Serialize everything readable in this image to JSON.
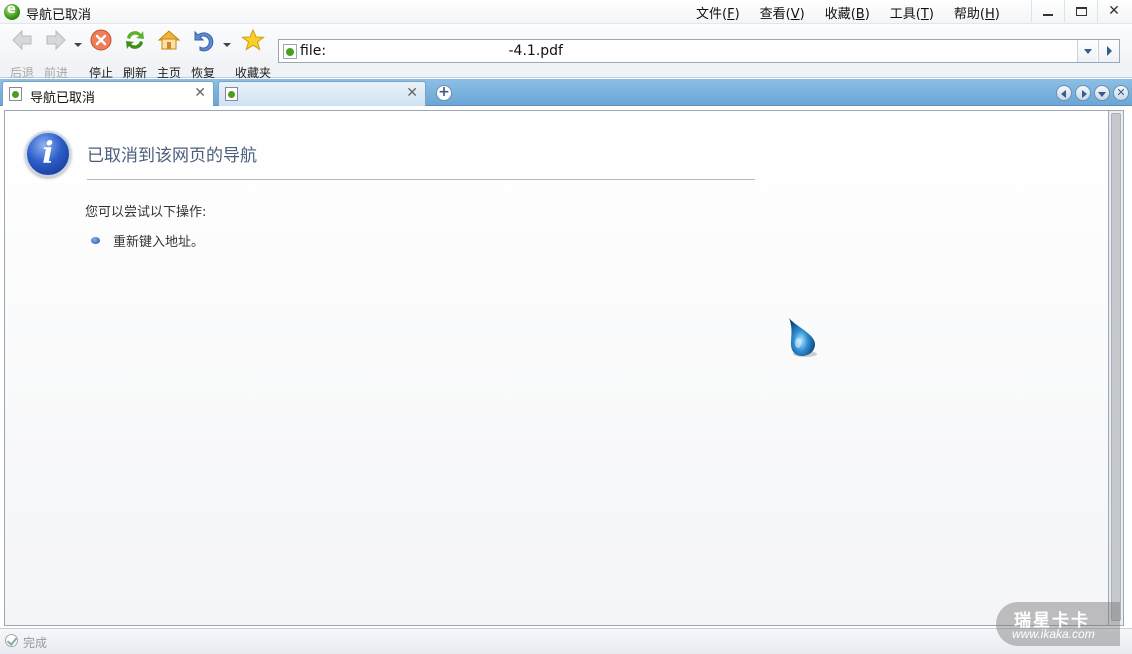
{
  "window": {
    "title": "导航已取消"
  },
  "menu": [
    {
      "label": "文件(",
      "key": "F",
      "suffix": ")"
    },
    {
      "label": "查看(",
      "key": "V",
      "suffix": ")"
    },
    {
      "label": "收藏(",
      "key": "B",
      "suffix": ")"
    },
    {
      "label": "工具(",
      "key": "T",
      "suffix": ")"
    },
    {
      "label": "帮助(",
      "key": "H",
      "suffix": ")"
    }
  ],
  "toolbar": {
    "back_label": "后退",
    "forward_label": "前进",
    "stop_label": "停止",
    "refresh_label": "刷新",
    "home_label": "主页",
    "restore_label": "恢复",
    "favorites_label": "收藏夹"
  },
  "address": {
    "value": "file:                                         -4.1.pdf"
  },
  "tabs": [
    {
      "title": "导航已取消",
      "active": true
    },
    {
      "title": "",
      "active": false
    }
  ],
  "content": {
    "title": "已取消到该网页的导航",
    "hint": "您可以尝试以下操作:",
    "actions": [
      "重新键入地址。"
    ]
  },
  "status": {
    "text": "完成"
  },
  "watermark": {
    "line1": "瑞星卡卡",
    "line2": "www.ikaka.com"
  },
  "colors": {
    "tabbar": "#7ab3de",
    "title_text": "#4b5e7a",
    "info_blue": "#2d5ec8"
  }
}
